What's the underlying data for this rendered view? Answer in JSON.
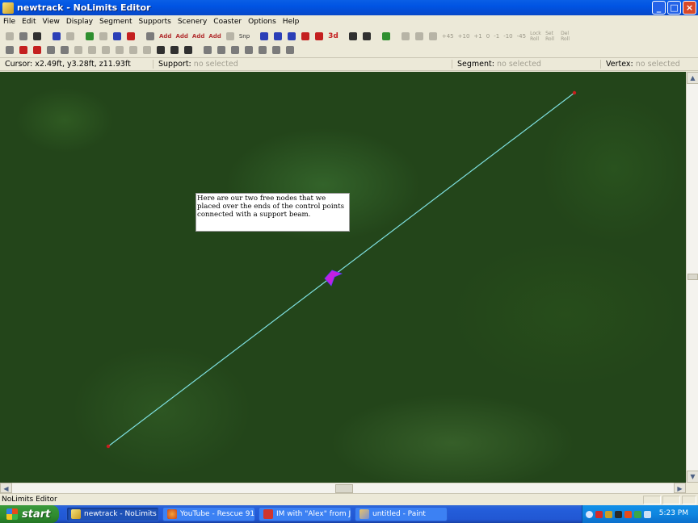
{
  "window": {
    "title": "newtrack - NoLimits Editor",
    "controls": [
      "minimize-icon",
      "maximize-icon",
      "close-icon"
    ]
  },
  "menu": [
    "File",
    "Edit",
    "View",
    "Display",
    "Segment",
    "Supports",
    "Scenery",
    "Coaster",
    "Options",
    "Help"
  ],
  "toolbar": {
    "snp_label": "Snp",
    "three_d_label": "3d",
    "add_labels": [
      "Add",
      "Add",
      "Add",
      "Add"
    ],
    "angle_labels": [
      "+45",
      "+10",
      "+1",
      "0",
      "-1",
      "-10",
      "-45"
    ],
    "lock_roll_label": "Lock Roll",
    "set_roll_label": "Set Roll",
    "del_roll_label": "Del Roll"
  },
  "status": {
    "cursor_label": "Cursor:",
    "cursor_value": "x2.49ft, y3.28ft, z11.93ft",
    "support_label": "Support:",
    "support_value": "no selected",
    "segment_label": "Segment:",
    "segment_value": "no selected",
    "vertex_label": "Vertex:",
    "vertex_value": "no selected"
  },
  "viewport": {
    "note": "Here are our two free nodes that we placed over the ends of the control points connected with a support beam.",
    "beam_color": "#7FE0E0",
    "node_color": "#C81E1E",
    "marker_color": "#C21FE0"
  },
  "app_status": "NoLimits Editor",
  "taskbar": {
    "start_label": "start",
    "tasks": [
      {
        "label": "newtrack - NoLimits E...",
        "icon": "nolimits-icon"
      },
      {
        "label": "YouTube - Rescue 91...",
        "icon": "firefox-icon"
      },
      {
        "label": "IM with \"Alex\" from J...",
        "icon": "gmail-icon"
      },
      {
        "label": "untitled - Paint",
        "icon": "paint-icon"
      }
    ],
    "clock": "5:23 PM"
  }
}
